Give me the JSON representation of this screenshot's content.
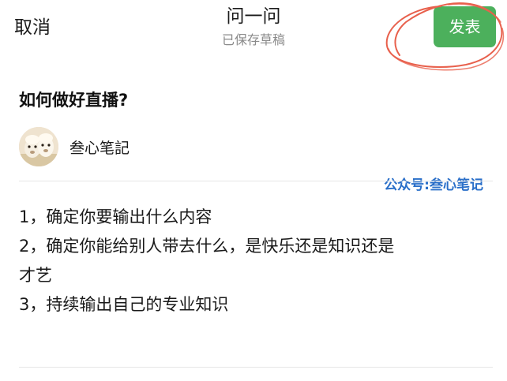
{
  "header": {
    "cancel_label": "取消",
    "title": "问一问",
    "draft_status": "已保存草稿",
    "publish_label": "发表"
  },
  "question": {
    "title": "如何做好直播?"
  },
  "author": {
    "name": "叁心笔記",
    "avatar_icon": "alpaca-avatar"
  },
  "watermark": {
    "text": "公众号:叁心笔记"
  },
  "answer": {
    "lines": [
      "1，确定你要输出什么内容",
      "2，确定你能给别人带去什么，是快乐还是知识还是",
      "才艺",
      "3，持续输出自己的专业知识"
    ]
  },
  "colors": {
    "publish_green": "#4cb05c",
    "scribble_red": "#e8604c",
    "watermark_blue": "#2a6fc9"
  }
}
